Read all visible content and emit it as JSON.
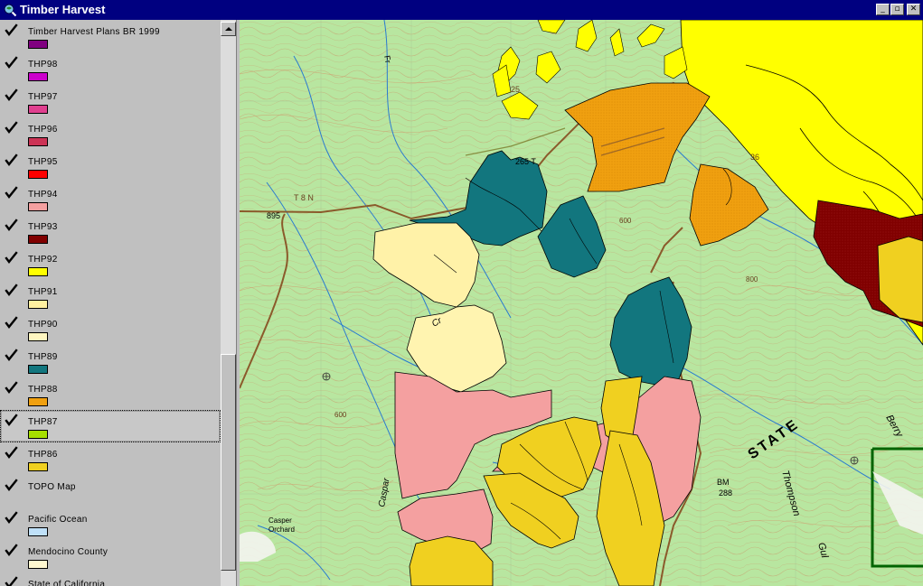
{
  "window": {
    "title": "Timber Harvest"
  },
  "window_buttons": [
    {
      "name": "minimize-button",
      "glyph": "_"
    },
    {
      "name": "maximize-button",
      "glyph": "▫"
    },
    {
      "name": "close-button",
      "glyph": "✕"
    }
  ],
  "layers": [
    {
      "label": "Timber Harvest Plans BR 1999",
      "color": "#800080",
      "checked": true
    },
    {
      "label": "THP98",
      "color": "#cc00cc",
      "checked": true
    },
    {
      "label": "THP97",
      "color": "#e0408f",
      "checked": true
    },
    {
      "label": "THP96",
      "color": "#cc3355",
      "checked": true
    },
    {
      "label": "THP95",
      "color": "#ff0000",
      "checked": true
    },
    {
      "label": "THP94",
      "color": "#f4a0a0",
      "checked": true
    },
    {
      "label": "THP93",
      "color": "#800000",
      "checked": true
    },
    {
      "label": "THP92",
      "color": "#ffff00",
      "checked": true
    },
    {
      "label": "THP91",
      "color": "#fff0a0",
      "checked": true
    },
    {
      "label": "THP90",
      "color": "#fff6c0",
      "checked": true
    },
    {
      "label": "THP89",
      "color": "#12767e",
      "checked": true
    },
    {
      "label": "THP88",
      "color": "#f0a010",
      "checked": true
    },
    {
      "label": "THP87",
      "color": "#a6e000",
      "checked": true,
      "selected": true
    },
    {
      "label": "THP86",
      "color": "#f0d020",
      "checked": true
    },
    {
      "label": "TOPO Map",
      "color": null,
      "checked": true
    },
    {
      "label": "Pacific Ocean",
      "color": "#bfe0f8",
      "checked": true
    },
    {
      "label": "Mendocino County",
      "color": "#fff8d0",
      "checked": true
    },
    {
      "label": "State of California",
      "color": "#ffffff",
      "checked": true
    }
  ],
  "map": {
    "labels": [
      {
        "name": "map-label-state",
        "text": "STATE"
      },
      {
        "name": "map-label-thompson",
        "text": "Thompson"
      },
      {
        "name": "map-label-gulch",
        "text": "Gul"
      },
      {
        "name": "map-label-berry",
        "text": "Berry"
      },
      {
        "name": "map-label-casper-orchard-1",
        "text": "Casper"
      },
      {
        "name": "map-label-casper-orchard-2",
        "text": "Orchard"
      },
      {
        "name": "map-label-caspar-creek",
        "text": "Caspar"
      },
      {
        "name": "map-label-creek",
        "text": "Cr"
      },
      {
        "name": "map-label-bm",
        "text": "BM"
      },
      {
        "name": "map-label-bm-elev",
        "text": "288"
      },
      {
        "name": "map-label-t8n",
        "text": "T 8 N"
      },
      {
        "name": "map-label-895",
        "text": "895"
      },
      {
        "name": "map-label-fr",
        "text": "Fr"
      },
      {
        "name": "map-label-25",
        "text": "25"
      },
      {
        "name": "map-label-36",
        "text": "36"
      },
      {
        "name": "map-label-265",
        "text": "265 T"
      },
      {
        "name": "map-label-600",
        "text": "600"
      },
      {
        "name": "map-label-600b",
        "text": "600"
      },
      {
        "name": "map-label-800",
        "text": "800"
      }
    ]
  }
}
